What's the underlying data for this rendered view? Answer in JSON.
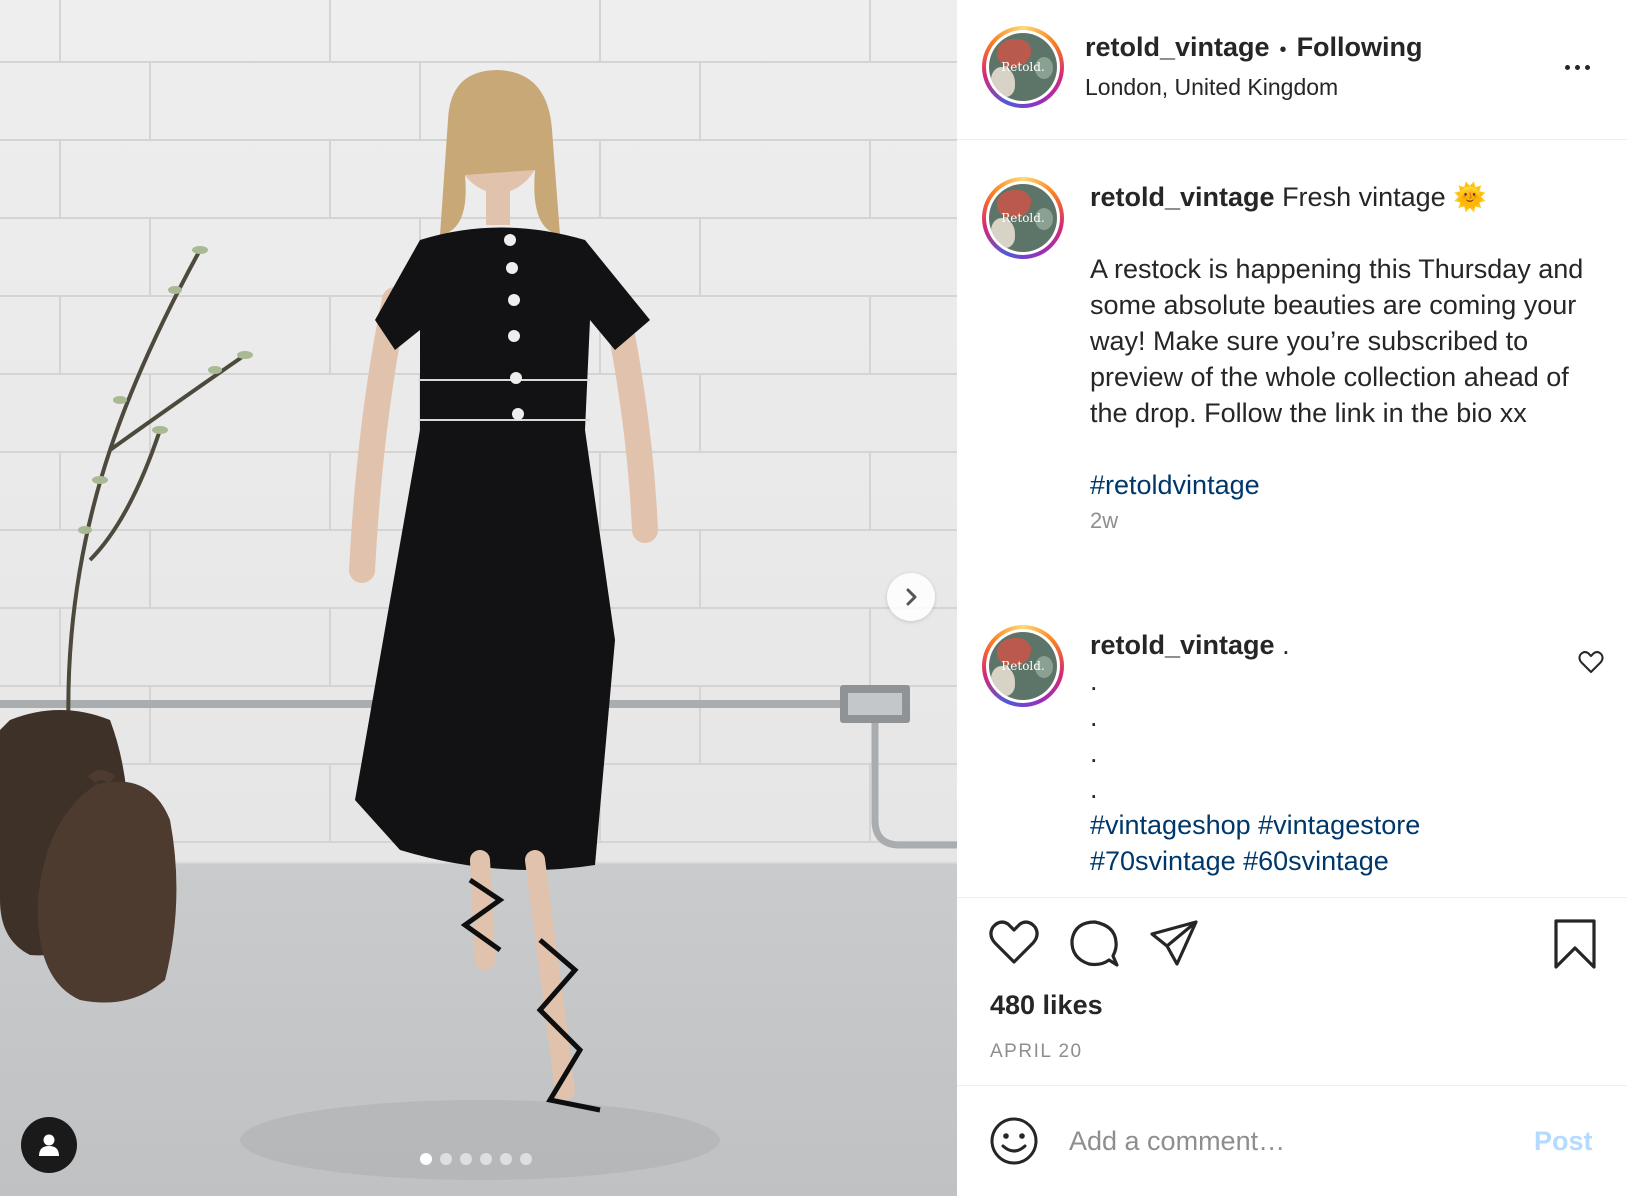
{
  "post": {
    "image": {
      "carousel_count": 6,
      "carousel_index": 1,
      "next_icon": "chevron-right-icon",
      "tag_icon": "user-icon"
    },
    "header": {
      "username": "retold_vintage",
      "separator": "•",
      "follow_status": "Following",
      "location": "London, United Kingdom",
      "avatar_text": "Retold.",
      "more_icon": "more-icon"
    },
    "caption": {
      "username": "retold_vintage",
      "title": "Fresh vintage 🌞",
      "body": "A restock is happening this Thursday and some absolute beauties are coming your way! Make sure you’re subscribed to preview of the whole collection ahead of the drop. Follow the link in the bio xx",
      "hashtag": "#retoldvintage",
      "time": "2w"
    },
    "reply": {
      "username": "retold_vintage",
      "first_line": ".",
      "dots": [
        ".",
        ".",
        ".",
        "."
      ],
      "hashtags_line1": "#vintageshop #vintagestore",
      "hashtags_line2": "#70svintage #60svintage"
    },
    "actions": {
      "like_icon": "heart-icon",
      "comment_icon": "comment-icon",
      "share_icon": "send-icon",
      "save_icon": "bookmark-icon",
      "likes": "480 likes",
      "date": "APRIL 20"
    },
    "composer": {
      "emoji_icon": "smiley-icon",
      "placeholder": "Add a comment…",
      "post_label": "Post"
    },
    "colors": {
      "link": "#00376b",
      "muted": "#8e8e8e",
      "post_disabled": "#b3dbff",
      "text": "#262626"
    }
  }
}
